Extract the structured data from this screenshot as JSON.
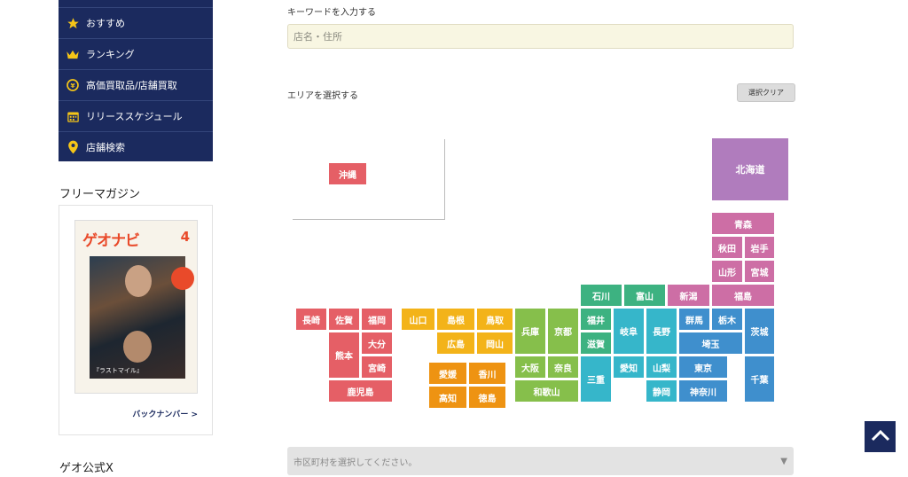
{
  "sidebar": {
    "menu": [
      {
        "label": "おすすめ",
        "icon": "star-icon"
      },
      {
        "label": "ランキング",
        "icon": "crown-icon"
      },
      {
        "label": "高価買取品/店舗買取",
        "icon": "buyback-icon"
      },
      {
        "label": "リリーススケジュール",
        "icon": "calendar-icon"
      },
      {
        "label": "店舗検索",
        "icon": "map-pin-icon"
      }
    ],
    "magazine_heading": "フリーマガジン",
    "magazine": {
      "cover_title": "ゲオナビ",
      "cover_month": "4",
      "cover_caption": "『ラストマイル』",
      "back_number_label": "バックナンバー >"
    },
    "official_x_heading": "ゲオ公式X"
  },
  "search": {
    "keyword_label": "キーワードを入力する",
    "keyword_placeholder": "店名・住所",
    "area_label": "エリアを選択する",
    "clear_label": "選択クリア"
  },
  "prefectures": {
    "okinawa": "沖縄",
    "hokkaido": "北海道",
    "aomori": "青森",
    "akita": "秋田",
    "iwate": "岩手",
    "yamagata": "山形",
    "miyagi": "宮城",
    "ishikawa": "石川",
    "toyama": "富山",
    "niigata": "新潟",
    "fukushima": "福島",
    "nagasaki": "長崎",
    "saga": "佐賀",
    "fukuoka": "福岡",
    "yamaguchi": "山口",
    "shimane": "島根",
    "tottori": "鳥取",
    "hyogo": "兵庫",
    "kyoto": "京都",
    "fukui": "福井",
    "gifu": "岐阜",
    "nagano": "長野",
    "gunma": "群馬",
    "tochigi": "栃木",
    "ibaraki": "茨城",
    "oita": "大分",
    "kumamoto": "熊本",
    "hiroshima": "広島",
    "okayama": "岡山",
    "shiga": "滋賀",
    "saitama": "埼玉",
    "miyazaki": "宮崎",
    "ehime": "愛媛",
    "kagawa": "香川",
    "osaka": "大阪",
    "nara": "奈良",
    "aichi": "愛知",
    "yamanashi": "山梨",
    "tokyo": "東京",
    "chiba": "千葉",
    "mie": "三重",
    "kagoshima": "鹿児島",
    "kochi": "高知",
    "tokushima": "徳島",
    "wakayama": "和歌山",
    "shizuoka": "静岡",
    "kanagawa": "神奈川"
  },
  "city_select": {
    "placeholder": "市区町村を選択してください。"
  },
  "colors": {
    "navy": "#1b2a5e",
    "hokkaido": "#b07cbd",
    "tohoku": "#cd6ea5",
    "kanto": "#3f8fcd",
    "chubu": "#36b6ca",
    "hokuriku": "#3db281",
    "kinki": "#86bf4b",
    "chugoku": "#f3b319",
    "shikoku": "#ee9312",
    "kyushu": "#e55f66"
  }
}
